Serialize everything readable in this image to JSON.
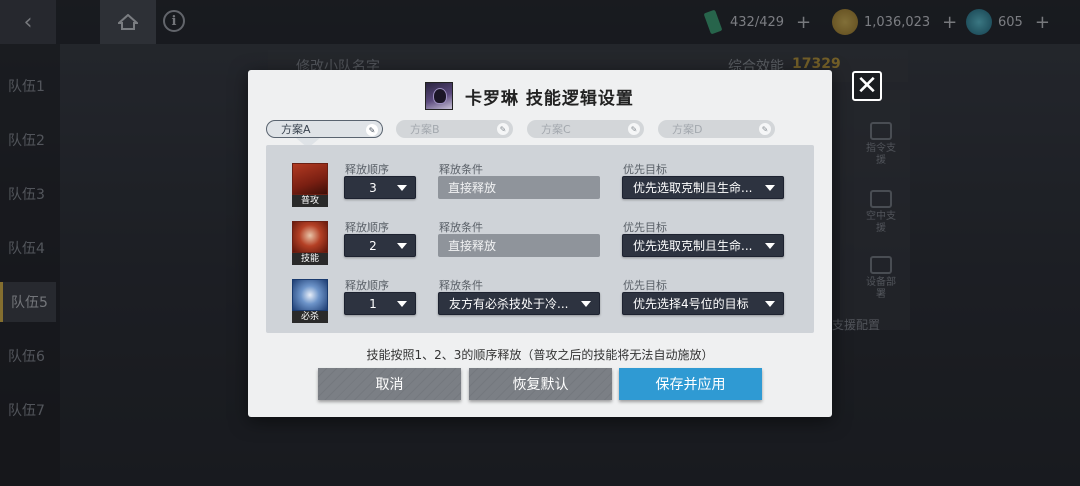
{
  "topbar": {
    "resources": [
      {
        "icon": "stamina-icon",
        "value": "432/429",
        "color": "#3fae7c"
      },
      {
        "icon": "coin-icon",
        "value": "1,036,023",
        "color": "#c9a53c"
      },
      {
        "icon": "crystal-icon",
        "value": "605",
        "color": "#3aa3b8"
      }
    ],
    "plus": "+"
  },
  "sidebar": {
    "teams": [
      "队伍1",
      "队伍2",
      "队伍3",
      "队伍4",
      "队伍5",
      "队伍6",
      "队伍7"
    ],
    "active_index": 4
  },
  "background": {
    "rename_label": "修改小队名字",
    "score_label": "综合效能",
    "score_value": "17329",
    "side_buttons": [
      "指令支援",
      "空中支援",
      "设备部署"
    ],
    "support_label": "支援配置"
  },
  "modal": {
    "title": "卡罗琳  技能逻辑设置",
    "close_symbol": "✕",
    "tabs": [
      {
        "label": "方案A",
        "active": true
      },
      {
        "label": "方案B",
        "active": false
      },
      {
        "label": "方案C",
        "active": false
      },
      {
        "label": "方案D",
        "active": false
      }
    ],
    "edit_symbol": "✎",
    "col_order": "释放顺序",
    "col_condition": "释放条件",
    "col_target": "优先目标",
    "skills": [
      {
        "icon": "normal-attack-icon",
        "badge": "普攻",
        "order": "3",
        "condition": "直接释放",
        "condition_dropdown": false,
        "target": "优先选取克制且生命..."
      },
      {
        "icon": "skill-icon",
        "badge": "技能",
        "order": "2",
        "condition": "直接释放",
        "condition_dropdown": false,
        "target": "优先选取克制且生命..."
      },
      {
        "icon": "ultimate-icon",
        "badge": "必杀",
        "order": "1",
        "condition": "友方有必杀技处于冷...",
        "condition_dropdown": true,
        "target": "优先选择4号位的目标"
      }
    ],
    "note": "技能按照1、2、3的顺序释放（普攻之后的技能将无法自动施放）",
    "buttons": {
      "cancel": "取消",
      "reset": "恢复默认",
      "save": "保存并应用"
    }
  }
}
